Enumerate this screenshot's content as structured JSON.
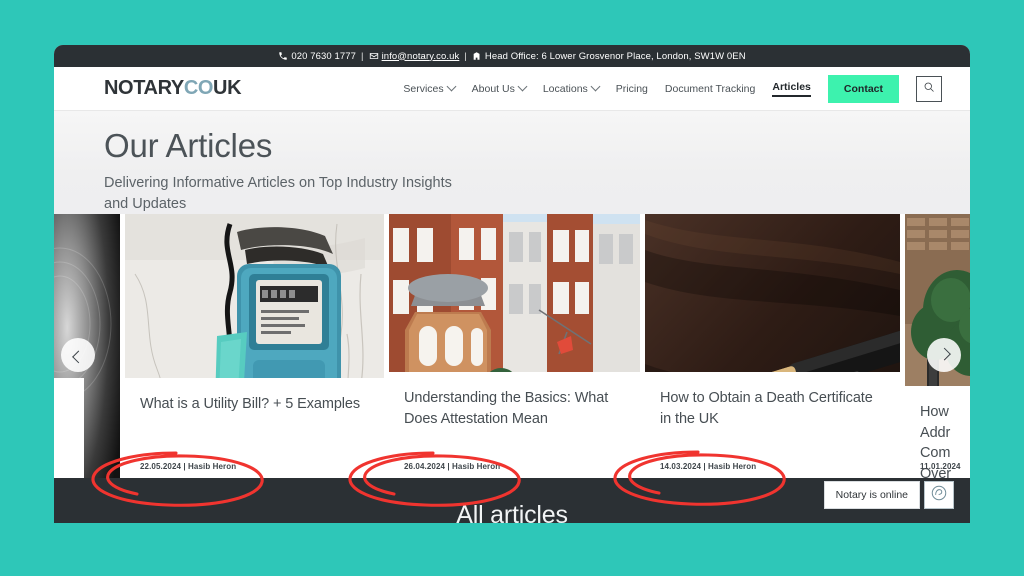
{
  "theme": {
    "page_background": "#2ec7b8",
    "topbar_background": "#2b3034",
    "accent_green": "#3df2ae",
    "annotation_red": "#f0342f",
    "logo_accent": "#7fa6b5"
  },
  "topbar": {
    "phone_icon": "phone-icon",
    "phone": "020 7630 1777",
    "mail_icon": "envelope-icon",
    "email": "info@notary.co.uk",
    "office_icon": "building-icon",
    "office": "Head Office: 6 Lower Grosvenor Place, London, SW1W 0EN",
    "separator": "|"
  },
  "header": {
    "logo": {
      "part1": "NOTARY",
      "part2": "CO",
      "part3": "UK"
    },
    "nav": [
      {
        "label": "Services",
        "has_caret": true,
        "active": false
      },
      {
        "label": "About Us",
        "has_caret": true,
        "active": false
      },
      {
        "label": "Locations",
        "has_caret": true,
        "active": false
      },
      {
        "label": "Pricing",
        "has_caret": false,
        "active": false
      },
      {
        "label": "Document Tracking",
        "has_caret": false,
        "active": false
      },
      {
        "label": "Articles",
        "has_caret": false,
        "active": true
      }
    ],
    "contact_label": "Contact",
    "search_icon": "search-icon"
  },
  "hero": {
    "title": "Our Articles",
    "subtitle": "Delivering Informative Articles on Top Industry Insights and Updates"
  },
  "carousel": {
    "prev_icon": "chevron-left-icon",
    "next_icon": "chevron-right-icon",
    "cards": [
      {
        "title": "",
        "meta": ""
      },
      {
        "title": "What is a Utility Bill? + 5 Examples",
        "meta": "22.05.2024 | Hasib Heron"
      },
      {
        "title": "Understanding the Basics: What Does Attestation Mean",
        "meta": "26.04.2024 | Hasib Heron"
      },
      {
        "title": "How to Obtain a Death Certificate in the UK",
        "meta": "14.03.2024 | Hasib Heron"
      },
      {
        "title": "How  Addr  Com  Over",
        "meta": "11.01.2024"
      }
    ]
  },
  "footer": {
    "heading": "All articles"
  },
  "chat": {
    "label": "Notary is online",
    "icon": "headset-icon"
  }
}
